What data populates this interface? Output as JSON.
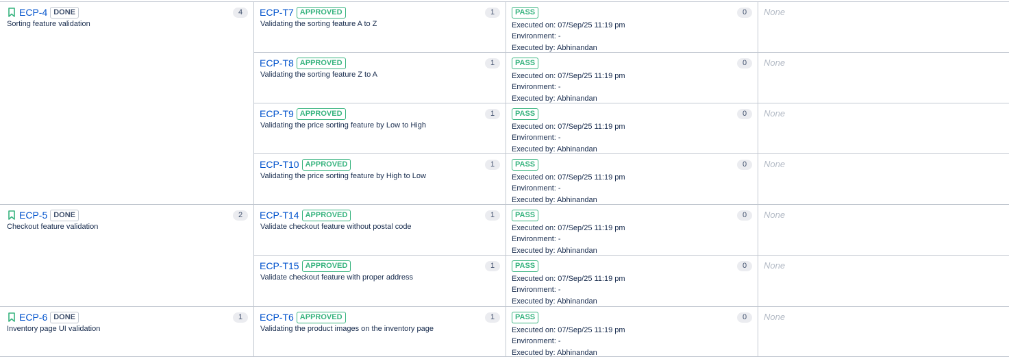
{
  "colors": {
    "link": "#0052cc",
    "approved": "#36b37e",
    "pass": "#36b37e",
    "bookmark": "#36b37e",
    "border": "#c1c7d0",
    "muted": "#b3bac5"
  },
  "labels": {
    "executed_on": "Executed on:",
    "environment": "Environment:",
    "executed_by": "Executed by:"
  },
  "requirements": [
    {
      "key": "ECP-4",
      "status": "DONE",
      "summary": "Sorting feature validation",
      "count": "4"
    },
    {
      "key": "ECP-5",
      "status": "DONE",
      "summary": "Checkout feature validation",
      "count": "2"
    },
    {
      "key": "ECP-6",
      "status": "DONE",
      "summary": "Inventory page UI validation",
      "count": "1"
    }
  ],
  "test_cases": [
    {
      "key": "ECP-T7",
      "status": "APPROVED",
      "summary": "Validating the sorting feature A to Z",
      "count": "1",
      "execution": {
        "result": "PASS",
        "executed_on": "07/Sep/25 11:19 pm",
        "environment": "-",
        "executed_by": "Abhinandan",
        "defects_count": "0"
      },
      "defects": "None"
    },
    {
      "key": "ECP-T8",
      "status": "APPROVED",
      "summary": "Validating the sorting feature Z to A",
      "count": "1",
      "execution": {
        "result": "PASS",
        "executed_on": "07/Sep/25 11:19 pm",
        "environment": "-",
        "executed_by": "Abhinandan",
        "defects_count": "0"
      },
      "defects": "None"
    },
    {
      "key": "ECP-T9",
      "status": "APPROVED",
      "summary": "Validating the price sorting feature by Low to High",
      "count": "1",
      "execution": {
        "result": "PASS",
        "executed_on": "07/Sep/25 11:19 pm",
        "environment": "-",
        "executed_by": "Abhinandan",
        "defects_count": "0"
      },
      "defects": "None"
    },
    {
      "key": "ECP-T10",
      "status": "APPROVED",
      "summary": "Validating the price sorting feature by High to Low",
      "count": "1",
      "execution": {
        "result": "PASS",
        "executed_on": "07/Sep/25 11:19 pm",
        "environment": "-",
        "executed_by": "Abhinandan",
        "defects_count": "0"
      },
      "defects": "None"
    },
    {
      "key": "ECP-T14",
      "status": "APPROVED",
      "summary": "Validate checkout feature without postal code",
      "count": "1",
      "execution": {
        "result": "PASS",
        "executed_on": "07/Sep/25 11:19 pm",
        "environment": "-",
        "executed_by": "Abhinandan",
        "defects_count": "0"
      },
      "defects": "None"
    },
    {
      "key": "ECP-T15",
      "status": "APPROVED",
      "summary": "Validate checkout feature with proper address",
      "count": "1",
      "execution": {
        "result": "PASS",
        "executed_on": "07/Sep/25 11:19 pm",
        "environment": "-",
        "executed_by": "Abhinandan",
        "defects_count": "0"
      },
      "defects": "None"
    },
    {
      "key": "ECP-T6",
      "status": "APPROVED",
      "summary": "Validating the product images on the inventory page",
      "count": "1",
      "execution": {
        "result": "PASS",
        "executed_on": "07/Sep/25 11:19 pm",
        "environment": "-",
        "executed_by": "Abhinandan",
        "defects_count": "0"
      },
      "defects": "None"
    }
  ]
}
